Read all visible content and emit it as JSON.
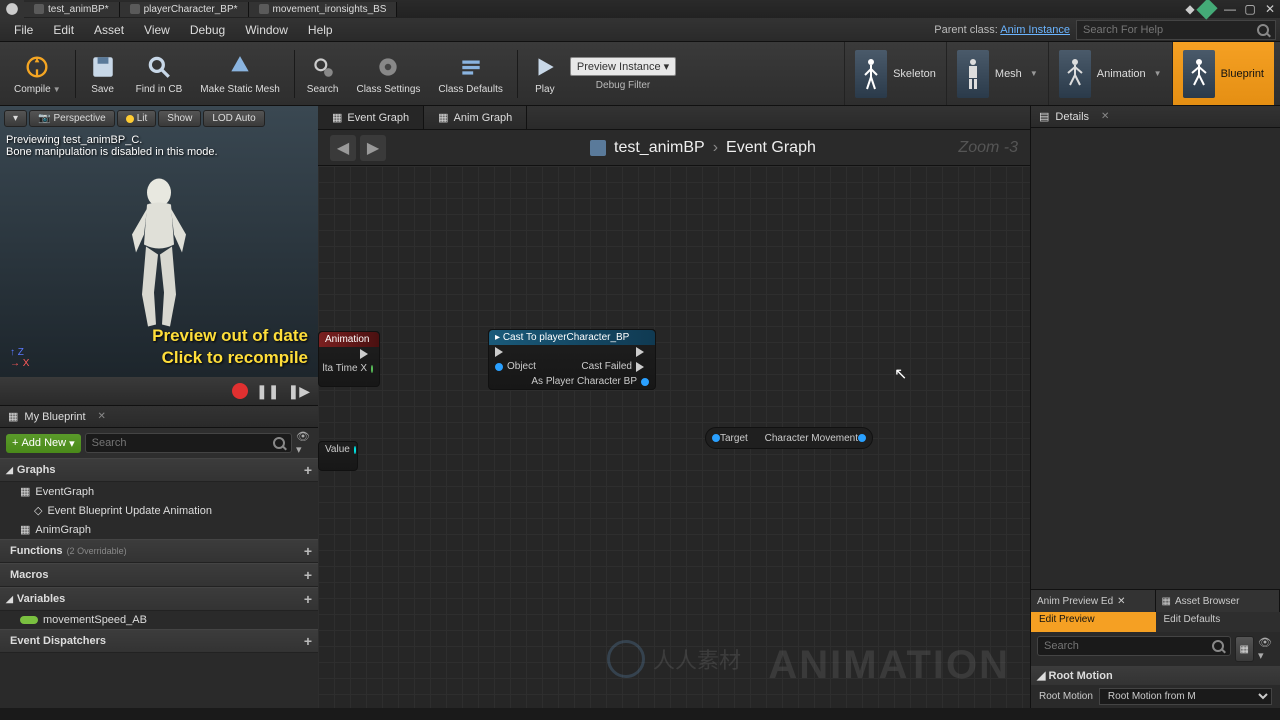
{
  "topTabs": [
    "test_animBP*",
    "playerCharacter_BP*",
    "movement_ironsights_BS"
  ],
  "menu": {
    "items": [
      "File",
      "Edit",
      "Asset",
      "View",
      "Debug",
      "Window",
      "Help"
    ],
    "parentClassLabel": "Parent class:",
    "parentClass": "Anim Instance",
    "searchPlaceholder": "Search For Help"
  },
  "toolbar": {
    "compile": "Compile",
    "save": "Save",
    "findInCB": "Find in CB",
    "makeStaticMesh": "Make Static Mesh",
    "search": "Search",
    "classSettings": "Class Settings",
    "classDefaults": "Class Defaults",
    "play": "Play",
    "debugSelect": "Preview Instance ▾",
    "debugLabel": "Debug Filter"
  },
  "modes": {
    "skeleton": "Skeleton",
    "mesh": "Mesh",
    "animation": "Animation",
    "blueprint": "Blueprint"
  },
  "viewport": {
    "buttons": {
      "perspective": "Perspective",
      "lit": "Lit",
      "show": "Show",
      "lod": "LOD Auto"
    },
    "previewLine1": "Previewing test_animBP_C.",
    "previewLine2": "Bone manipulation is disabled in this mode.",
    "warn1": "Preview out of date",
    "warn2": "Click to recompile",
    "axisZ": "Z",
    "axisX": "X"
  },
  "myBlueprint": {
    "tab": "My Blueprint",
    "addNew": "Add New",
    "searchPlaceholder": "Search",
    "sections": {
      "graphs": "Graphs",
      "functions": "Functions",
      "functionsHint": "(2 Overridable)",
      "macros": "Macros",
      "variables": "Variables",
      "dispatchers": "Event Dispatchers"
    },
    "items": {
      "eventGraph": "EventGraph",
      "eventUpdate": "Event Blueprint Update Animation",
      "animGraph": "AnimGraph",
      "var1": "movementSpeed_AB"
    }
  },
  "graph": {
    "tabs": {
      "eventGraph": "Event Graph",
      "animGraph": "Anim Graph"
    },
    "breadcrumb": {
      "asset": "test_animBP",
      "current": "Event Graph"
    },
    "zoom": "Zoom -3",
    "nodes": {
      "anim": {
        "title": "Animation",
        "deltaTime": "lta Time X"
      },
      "cast": {
        "title": "Cast To playerCharacter_BP",
        "object": "Object",
        "castFailed": "Cast Failed",
        "asPlayer": "As Player Character BP"
      },
      "value": {
        "label": "Value"
      },
      "getter": {
        "target": "Target",
        "out": "Character Movement"
      }
    },
    "watermark": "ANIMATION",
    "centerWatermark": "人人素材"
  },
  "details": {
    "tab": "Details",
    "animPreview": "Anim Preview Ed",
    "assetBrowser": "Asset Browser",
    "editPreview": "Edit Preview",
    "editDefaults": "Edit Defaults",
    "searchPlaceholder": "Search",
    "rootMotionCat": "Root Motion",
    "rootMotionLabel": "Root Motion",
    "rootMotionValue": "Root Motion from M"
  }
}
